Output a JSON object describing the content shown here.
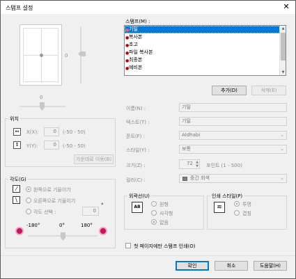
{
  "window": {
    "title": "스탬프 설정",
    "close_glyph": "✕"
  },
  "preview": {
    "h_value": "0",
    "v_value": "0"
  },
  "position": {
    "legend": "위치",
    "x_label": "X(X):",
    "x_value": "0",
    "x_range": "(-50 - 50)",
    "y_label": "Y(Y):",
    "y_value": "0",
    "y_range": "(-50 - 50)",
    "center_button": "가운데로 이동(B)"
  },
  "angle": {
    "legend": "각도(G)",
    "options": [
      "왼쪽으로 기울이기",
      "오른쪽으로 기울이기",
      "각도 선택 :"
    ],
    "selected": 0,
    "custom_value": "0",
    "degree_symbol": "°",
    "ticks": [
      "-180°",
      "0°",
      "180°"
    ]
  },
  "stamps": {
    "label": "스탬프(M) :",
    "items": [
      "기밀",
      "복사본",
      "초고",
      "파일 복사본",
      "최종본",
      "예비본"
    ],
    "selected": 0,
    "add_button": "추가(D)",
    "delete_button": "삭제(E)"
  },
  "props": {
    "name_label": "이름(N) :",
    "name_value": "기밀",
    "text_label": "텍스트(T) :",
    "text_value": "기밀",
    "font_label": "폰트(F) :",
    "font_value": "Aldhabi",
    "style_label": "스타일(Y) :",
    "style_value": "보통",
    "size_label": "크기(Z) :",
    "size_value": "72",
    "size_range": "포인트 (1 - 500)",
    "color_label": "컬러(C) :",
    "color_value": "중간 회색",
    "color_swatch": "#808080"
  },
  "outline": {
    "legend": "외곽선(U)",
    "options": [
      "원형",
      "사각형",
      "없음"
    ],
    "selected": 2,
    "icon_text": "AB"
  },
  "print_style": {
    "legend": "인쇄 스타일(P)",
    "options": [
      "투명",
      "겹침"
    ],
    "selected": 0
  },
  "first_page_only": {
    "label": "첫 페이지에만 스탬프 인쇄(O)",
    "checked": false
  },
  "footer": {
    "ok": "확인",
    "cancel": "취소",
    "help": "도움말(H)"
  }
}
